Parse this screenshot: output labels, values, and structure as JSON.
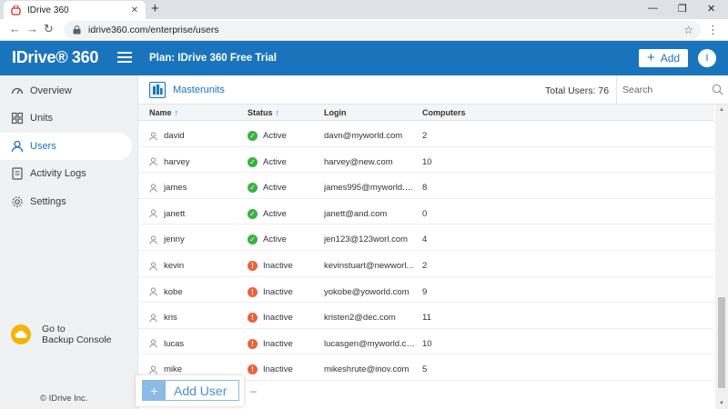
{
  "browser": {
    "tab_title": "IDrive 360",
    "tab_close": "✕",
    "new_tab": "+",
    "url": "idrive360.com/enterprise/users",
    "win_min": "—",
    "win_max": "❐",
    "win_close": "✕",
    "back": "←",
    "forward": "→",
    "reload": "↻",
    "star": "☆",
    "menu": "⋮"
  },
  "header": {
    "logo": "IDrive® 360",
    "plan": "Plan: IDrive 360 Free Trial",
    "add_plus": "+",
    "add_label": "Add",
    "avatar": "I",
    "accent": "#1a74bc"
  },
  "sidebar": {
    "items": [
      {
        "label": "Overview",
        "icon": "overview-icon"
      },
      {
        "label": "Units",
        "icon": "units-icon"
      },
      {
        "label": "Users",
        "icon": "user-icon",
        "active": true
      },
      {
        "label": "Activity Logs",
        "icon": "activity-log-icon"
      },
      {
        "label": "Settings",
        "icon": "gear-icon"
      }
    ],
    "backup_line1": "Go to",
    "backup_line2": "Backup Console",
    "copyright": "© IDrive Inc."
  },
  "toolbar": {
    "masterunits": "Masterunits",
    "total_users": "Total Users: 76",
    "search_placeholder": "Search"
  },
  "table": {
    "columns": {
      "name": "Name",
      "status": "Status",
      "login": "Login",
      "computers": "Computers"
    },
    "sort_arrow": "↑",
    "status_colors": {
      "Active": "#3cb043",
      "Inactive": "#e9623b"
    },
    "rows": [
      {
        "name": "david",
        "status": "Active",
        "login": "davn@myworld.com",
        "computers": "2"
      },
      {
        "name": "harvey",
        "status": "Active",
        "login": "harvey@new.com",
        "computers": "10"
      },
      {
        "name": "james",
        "status": "Active",
        "login": "james995@myworld.c...",
        "computers": "8"
      },
      {
        "name": "janett",
        "status": "Active",
        "login": "janett@and.com",
        "computers": "0"
      },
      {
        "name": "jenny",
        "status": "Active",
        "login": "jen123@123worl.com",
        "computers": "4"
      },
      {
        "name": "kevin",
        "status": "Inactive",
        "login": "kevinstuart@newworl...",
        "computers": "2"
      },
      {
        "name": "kobe",
        "status": "Inactive",
        "login": "yokobe@yoworld.com",
        "computers": "9"
      },
      {
        "name": "kris",
        "status": "Inactive",
        "login": "kristen2@dec.com",
        "computers": "11"
      },
      {
        "name": "lucas",
        "status": "Inactive",
        "login": "lucasgen@myworld.com",
        "computers": "10"
      },
      {
        "name": "mike",
        "status": "Inactive",
        "login": "mikeshrute@inov.com",
        "computers": "5"
      }
    ]
  },
  "add_user": {
    "plus": "+",
    "label": "Add User",
    "minus": "–"
  }
}
